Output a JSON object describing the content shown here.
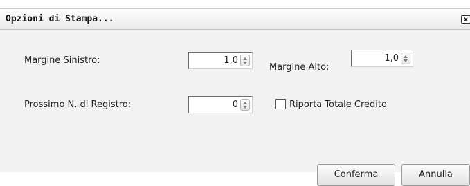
{
  "dialog": {
    "title": "Opzioni di Stampa...",
    "close_glyph": "x"
  },
  "fields": {
    "margine_sinistro": {
      "label": "Margine Sinistro:",
      "value": "1,0"
    },
    "margine_alto": {
      "label": "Margine Alto:",
      "value": "1,0"
    },
    "prossimo_registro": {
      "label": "Prossimo N. di Registro:",
      "value": "0"
    }
  },
  "checkbox": {
    "label": "Riporta Totale Credito",
    "checked": false
  },
  "buttons": {
    "confirm": "Conferma",
    "cancel": "Annulla"
  }
}
